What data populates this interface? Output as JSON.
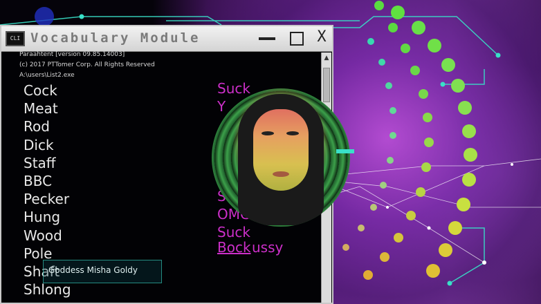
{
  "window": {
    "title": "Vocabulary Module",
    "icon_label": "CLI",
    "minimize_label": "",
    "maximize_label": "",
    "close_label": "X"
  },
  "console": {
    "lines": [
      "Paraahtent [version 09.85.14003]",
      "(c) 2017 PTTomer Corp. All Rights Reserved",
      "A:\\users\\List2.exe"
    ]
  },
  "vocabulary": [
    "Cock",
    "Meat",
    "Rod",
    "Dick",
    "Staff",
    "BBC",
    "Pecker",
    "Hung",
    "Wood",
    "Pole",
    "Shaft",
    "Shlong"
  ],
  "overlay_words": [
    "Suck",
    "Y",
    "S",
    "OMG",
    "Suck",
    "Bock",
    "ussy"
  ],
  "caption": "Goddess Misha Goldy",
  "scroll_up_glyph": "▲",
  "colors": {
    "accent_cyan": "#39e0c8",
    "pink_text": "#cc2fc9",
    "green_dots": "#74e050",
    "yellow_dots": "#e0d040"
  }
}
